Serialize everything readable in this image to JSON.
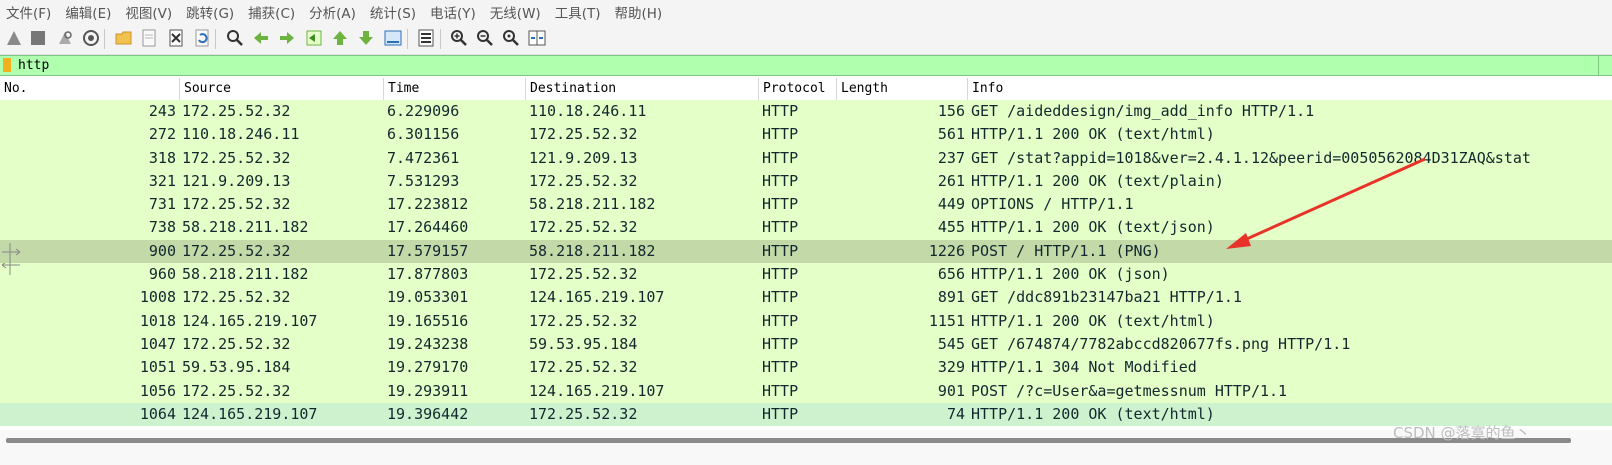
{
  "menu": [
    "文件(F)",
    "编辑(E)",
    "视图(V)",
    "跳转(G)",
    "捕获(C)",
    "分析(A)",
    "统计(S)",
    "电话(Y)",
    "无线(W)",
    "工具(T)",
    "帮助(H)"
  ],
  "toolbar_icons": [
    "shark-fin-start-icon",
    "stop-capture-icon",
    "restart-capture-icon",
    "capture-options-icon",
    "open-file-icon",
    "save-file-icon",
    "close-file-icon",
    "reload-file-icon",
    "find-packet-icon",
    "go-back-icon",
    "go-forward-icon",
    "go-to-packet-icon",
    "go-first-packet-icon",
    "go-last-packet-icon",
    "autoscroll-icon",
    "colorize-icon",
    "zoom-in-icon",
    "zoom-out-icon",
    "zoom-normal-icon",
    "resize-columns-icon"
  ],
  "filter": {
    "value": "http"
  },
  "columns": [
    "No.",
    "Source",
    "Time",
    "Destination",
    "Protocol",
    "Length",
    "Info"
  ],
  "packets": [
    {
      "no": "243",
      "source": "172.25.52.32",
      "time": "6.229096",
      "destination": "110.18.246.11",
      "protocol": "HTTP",
      "length": "156",
      "info": "GET /aideddesign/img_add_info HTTP/1.1"
    },
    {
      "no": "272",
      "source": "110.18.246.11",
      "time": "6.301156",
      "destination": "172.25.52.32",
      "protocol": "HTTP",
      "length": "561",
      "info": "HTTP/1.1 200 OK  (text/html)"
    },
    {
      "no": "318",
      "source": "172.25.52.32",
      "time": "7.472361",
      "destination": "121.9.209.13",
      "protocol": "HTTP",
      "length": "237",
      "info": "GET /stat?appid=1018&ver=2.4.1.12&peerid=0050562084D31ZAQ&stat"
    },
    {
      "no": "321",
      "source": "121.9.209.13",
      "time": "7.531293",
      "destination": "172.25.52.32",
      "protocol": "HTTP",
      "length": "261",
      "info": "HTTP/1.1 200 OK  (text/plain)"
    },
    {
      "no": "731",
      "source": "172.25.52.32",
      "time": "17.223812",
      "destination": "58.218.211.182",
      "protocol": "HTTP",
      "length": "449",
      "info": "OPTIONS / HTTP/1.1"
    },
    {
      "no": "738",
      "source": "58.218.211.182",
      "time": "17.264460",
      "destination": "172.25.52.32",
      "protocol": "HTTP",
      "length": "455",
      "info": "HTTP/1.1 200 OK  (text/json)"
    },
    {
      "no": "900",
      "source": "172.25.52.32",
      "time": "17.579157",
      "destination": "58.218.211.182",
      "protocol": "HTTP",
      "length": "1226",
      "info": "POST / HTTP/1.1  (PNG)"
    },
    {
      "no": "960",
      "source": "58.218.211.182",
      "time": "17.877803",
      "destination": "172.25.52.32",
      "protocol": "HTTP",
      "length": "656",
      "info": "HTTP/1.1 200 OK  (json)"
    },
    {
      "no": "1008",
      "source": "172.25.52.32",
      "time": "19.053301",
      "destination": "124.165.219.107",
      "protocol": "HTTP",
      "length": "891",
      "info": "GET /ddc891b23147ba21 HTTP/1.1"
    },
    {
      "no": "1018",
      "source": "124.165.219.107",
      "time": "19.165516",
      "destination": "172.25.52.32",
      "protocol": "HTTP",
      "length": "1151",
      "info": "HTTP/1.1 200 OK  (text/html)"
    },
    {
      "no": "1047",
      "source": "172.25.52.32",
      "time": "19.243238",
      "destination": "59.53.95.184",
      "protocol": "HTTP",
      "length": "545",
      "info": "GET /674874/7782abccd820677fs.png HTTP/1.1"
    },
    {
      "no": "1051",
      "source": "59.53.95.184",
      "time": "19.279170",
      "destination": "172.25.52.32",
      "protocol": "HTTP",
      "length": "329",
      "info": "HTTP/1.1 304 Not Modified"
    },
    {
      "no": "1056",
      "source": "172.25.52.32",
      "time": "19.293911",
      "destination": "124.165.219.107",
      "protocol": "HTTP",
      "length": "901",
      "info": "POST /?c=User&a=getmessnum HTTP/1.1"
    },
    {
      "no": "1064",
      "source": "124.165.219.107",
      "time": "19.396442",
      "destination": "172.25.52.32",
      "protocol": "HTTP",
      "length": "74",
      "info": "HTTP/1.1 200 OK  (text/html)"
    }
  ],
  "selected_row": 6,
  "response_marker_row": 7,
  "focus_row": 13,
  "colors": {
    "row_bg": "#e4ffc7",
    "selected_bg": "#c3d9a8",
    "filter_bg": "#afffaf",
    "annotation_arrow": "#e8332a"
  },
  "watermark": "CSDN @落寞的鱼丶"
}
